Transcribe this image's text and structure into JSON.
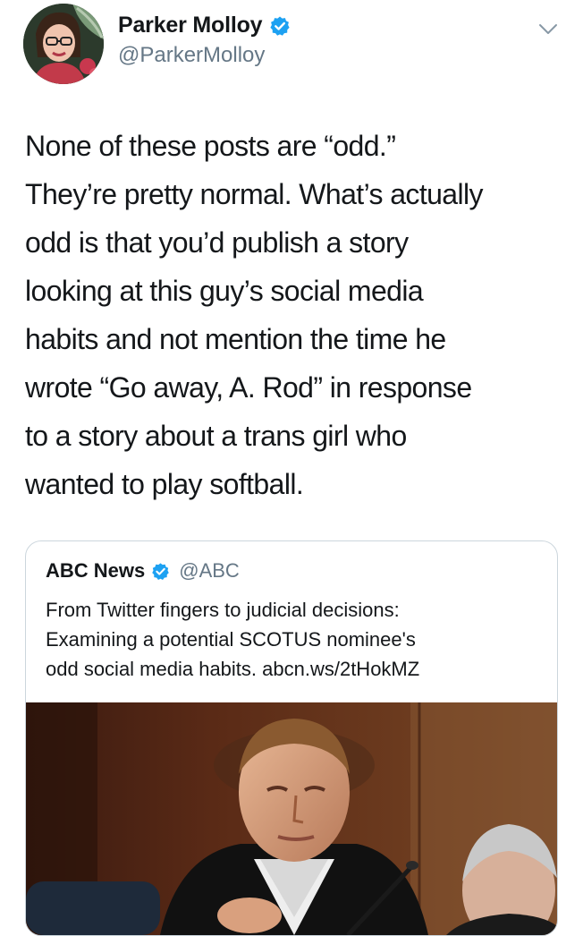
{
  "tweet": {
    "author": {
      "display_name": "Parker Molloy",
      "handle": "@ParkerMolloy",
      "verified": true
    },
    "menu_icon": "chevron-down-icon",
    "text_lines": [
      "None of these posts are “odd.”",
      "They’re pretty normal. What’s actually",
      "odd is that you’d publish a story",
      "looking at this guy’s social media",
      "habits and not mention the time he",
      "wrote “Go away, A. Rod” in response",
      "to a story about a trans girl who",
      "wanted to play softball."
    ]
  },
  "quoted_tweet": {
    "author": {
      "display_name": "ABC News",
      "handle": "@ABC",
      "verified": true
    },
    "text_lines": [
      "From Twitter fingers to judicial decisions:",
      "Examining a potential SCOTUS nominee's",
      "odd social media habits. abcn.ws/2tHokMZ"
    ]
  },
  "colors": {
    "verified_blue": "#1da1f2",
    "secondary_text": "#657786",
    "border": "#ccd6dd",
    "primary_text": "#14171a"
  }
}
